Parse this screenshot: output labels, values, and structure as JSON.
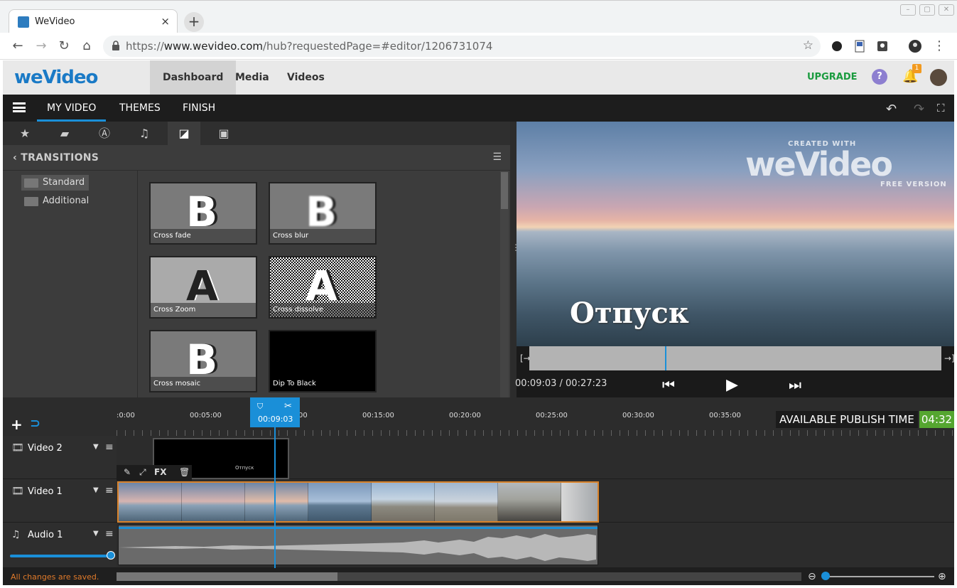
{
  "browser": {
    "tab_title": "WeVideo",
    "url_scheme": "https://",
    "url_host": "www.wevideo.com",
    "url_path": "/hub?requestedPage=#editor/1206731074"
  },
  "header": {
    "logo": "weVideo",
    "nav": [
      {
        "label": "Dashboard",
        "active": true
      },
      {
        "label": "Media",
        "active": false
      },
      {
        "label": "Videos",
        "active": false
      }
    ],
    "upgrade_label": "UPGRADE",
    "help_label": "?",
    "notification_count": "1"
  },
  "editor": {
    "tabs": [
      "MY VIDEO",
      "THEMES",
      "FINISH"
    ],
    "active_tab": "MY VIDEO",
    "panel_title": "TRANSITIONS",
    "folders": [
      {
        "label": "Standard",
        "selected": true
      },
      {
        "label": "Additional",
        "selected": false
      }
    ],
    "transitions": [
      {
        "label": "Cross fade",
        "glyph": "B"
      },
      {
        "label": "Cross blur",
        "glyph": "B"
      },
      {
        "label": "Cross Zoom",
        "glyph": "A"
      },
      {
        "label": "Cross dissolve",
        "glyph": "A"
      },
      {
        "label": "Cross mosaic",
        "glyph": "B"
      },
      {
        "label": "Dip To Black",
        "glyph": ""
      }
    ],
    "preview": {
      "watermark_top": "CREATED WITH",
      "watermark_logo": "weVideo",
      "watermark_bottom": "FREE VERSION",
      "overlay_title": "Отпуск",
      "timecode": "00:09:03 / 00:27:23",
      "playhead_fraction": 0.33
    },
    "timeline": {
      "ticks": [
        ":0:00",
        "00:05:00",
        "00",
        "00:15:00",
        "00:20:00",
        "00:25:00",
        "00:30:00",
        "00:35:00"
      ],
      "playhead_time": "00:09:03",
      "publish_label": "AVAILABLE PUBLISH TIME",
      "publish_value": "04:32",
      "tracks": [
        {
          "name": "Video 2",
          "icon": "film-icon"
        },
        {
          "name": "Video 1",
          "icon": "film-icon"
        },
        {
          "name": "Audio 1",
          "icon": "music-icon"
        }
      ],
      "clip_text": "Отпуск",
      "fx_label": "FX",
      "status": "All changes are saved."
    }
  },
  "colors": {
    "accent": "#1a8fd8",
    "upgrade": "#1a9b3f",
    "publish_value_bg": "#55a630",
    "clip_border": "#d8822a",
    "status_text": "#e07a2a"
  }
}
